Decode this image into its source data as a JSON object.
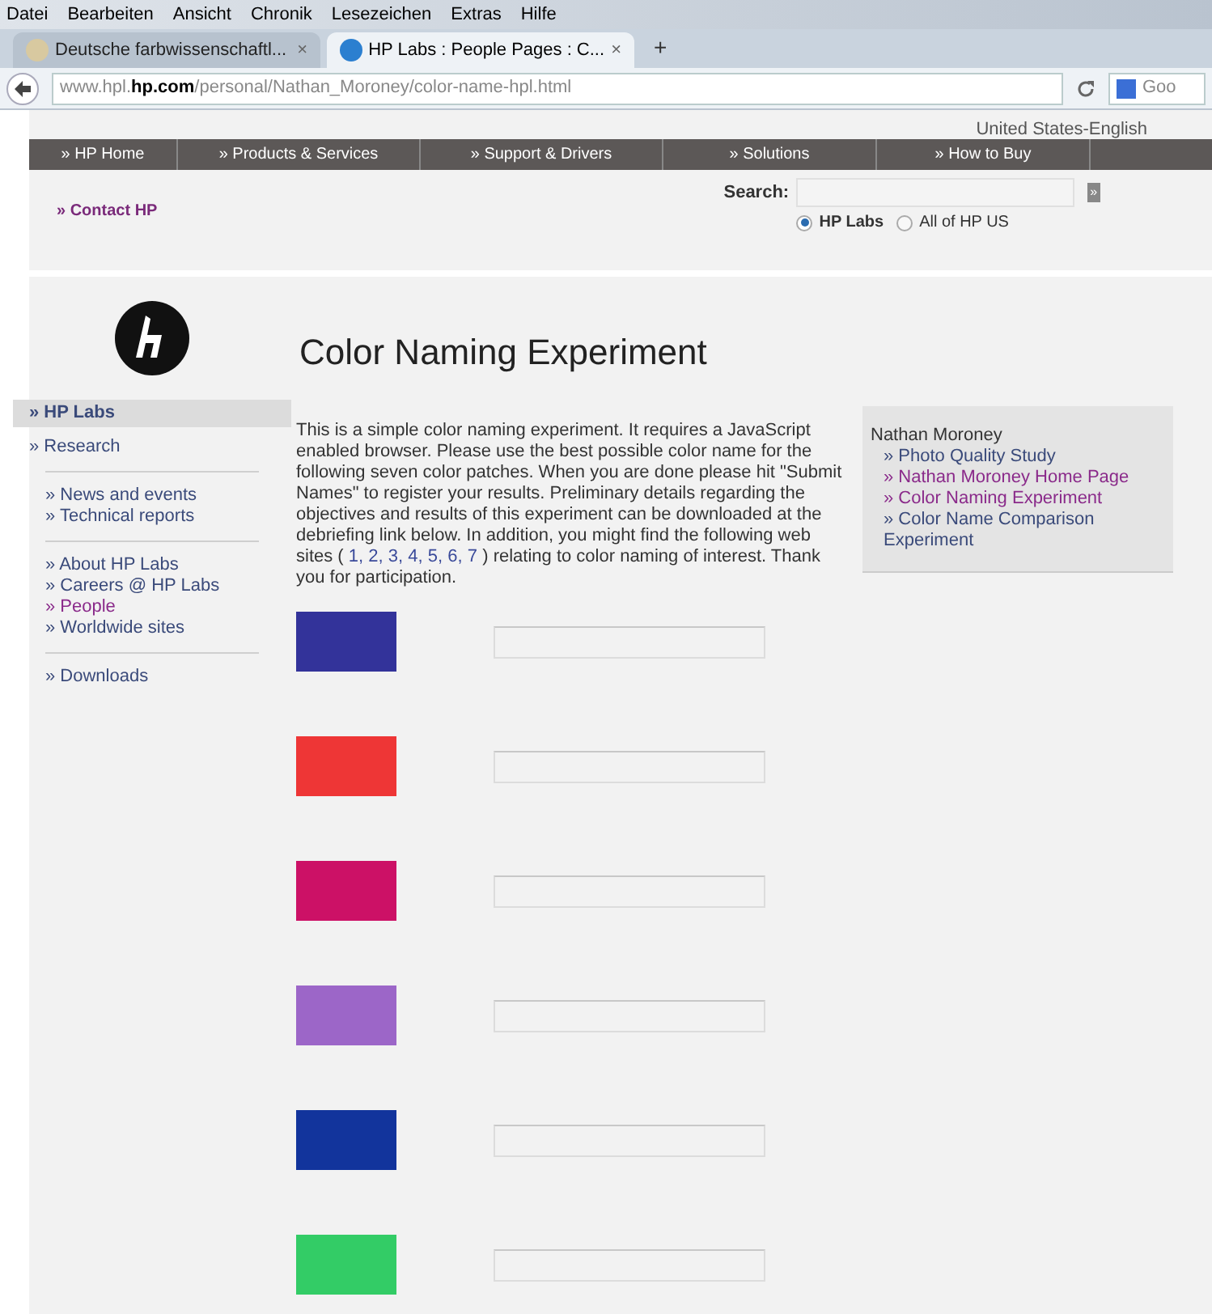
{
  "menu_bar": [
    "Datei",
    "Bearbeiten",
    "Ansicht",
    "Chronik",
    "Lesezeichen",
    "Extras",
    "Hilfe"
  ],
  "tabs": [
    {
      "label": "Deutsche farbwissenschaftl...",
      "selected": false,
      "close": "×"
    },
    {
      "label": "HP Labs : People Pages : C...",
      "selected": true,
      "close": "×"
    }
  ],
  "new_tab": "+",
  "address": {
    "prefix": "www.hpl.",
    "domain": "hp.com",
    "path": "/personal/Nathan_Moroney/color-name-hpl.html",
    "search_engine": "Goo"
  },
  "locale": "United States-English",
  "nav": [
    "» HP Home",
    "» Products & Services",
    "» Support & Drivers",
    "» Solutions",
    "» How to Buy"
  ],
  "contact": "» Contact HP",
  "search": {
    "label": "Search:",
    "button": "»",
    "scopes": [
      {
        "label": "HP Labs",
        "selected": true
      },
      {
        "label": "All of HP US",
        "selected": false
      }
    ]
  },
  "sidebar": {
    "groups": [
      [
        {
          "label": "» HP Labs",
          "selected": true,
          "visited": false
        },
        {
          "label": "» Research",
          "selected": false,
          "visited": false
        }
      ],
      [
        {
          "label": "» News and events",
          "selected": false,
          "visited": false
        },
        {
          "label": "» Technical reports",
          "selected": false,
          "visited": false
        }
      ],
      [
        {
          "label": "» About HP Labs",
          "selected": false,
          "visited": false
        },
        {
          "label": "» Careers @ HP Labs",
          "selected": false,
          "visited": false
        },
        {
          "label": "» People",
          "selected": false,
          "visited": true
        },
        {
          "label": "» Worldwide sites",
          "selected": false,
          "visited": false
        }
      ],
      [
        {
          "label": "» Downloads",
          "selected": false,
          "visited": false
        }
      ]
    ]
  },
  "title": "Color Naming Experiment",
  "intro": {
    "before": "This is a simple color naming experiment. It requires a JavaScript enabled browser. Please use the best possible color name for the following seven color patches. When you are done please hit \"Submit Names\" to register your results. Preliminary details regarding the objectives and results of this experiment can be downloaded at the debriefing link below. In addition, you might find the following web sites (",
    "links": [
      "1,",
      "2,",
      "3,",
      "4,",
      "5,",
      "6,",
      "7"
    ],
    "after": ") relating to color naming of interest. Thank you for participation."
  },
  "patches": [
    {
      "color": "#33339a"
    },
    {
      "color": "#ee3636"
    },
    {
      "color": "#cc1166"
    },
    {
      "color": "#9c66c8"
    },
    {
      "color": "#12349c"
    },
    {
      "color": "#33cc66"
    }
  ],
  "related": {
    "heading": "Nathan Moroney",
    "links": [
      {
        "label": "» Photo Quality Study",
        "visited": false
      },
      {
        "label": "» Nathan Moroney Home Page",
        "visited": true
      },
      {
        "label": "» Color Naming Experiment",
        "visited": true
      },
      {
        "label": "» Color Name Comparison Experiment",
        "visited": false
      }
    ]
  }
}
